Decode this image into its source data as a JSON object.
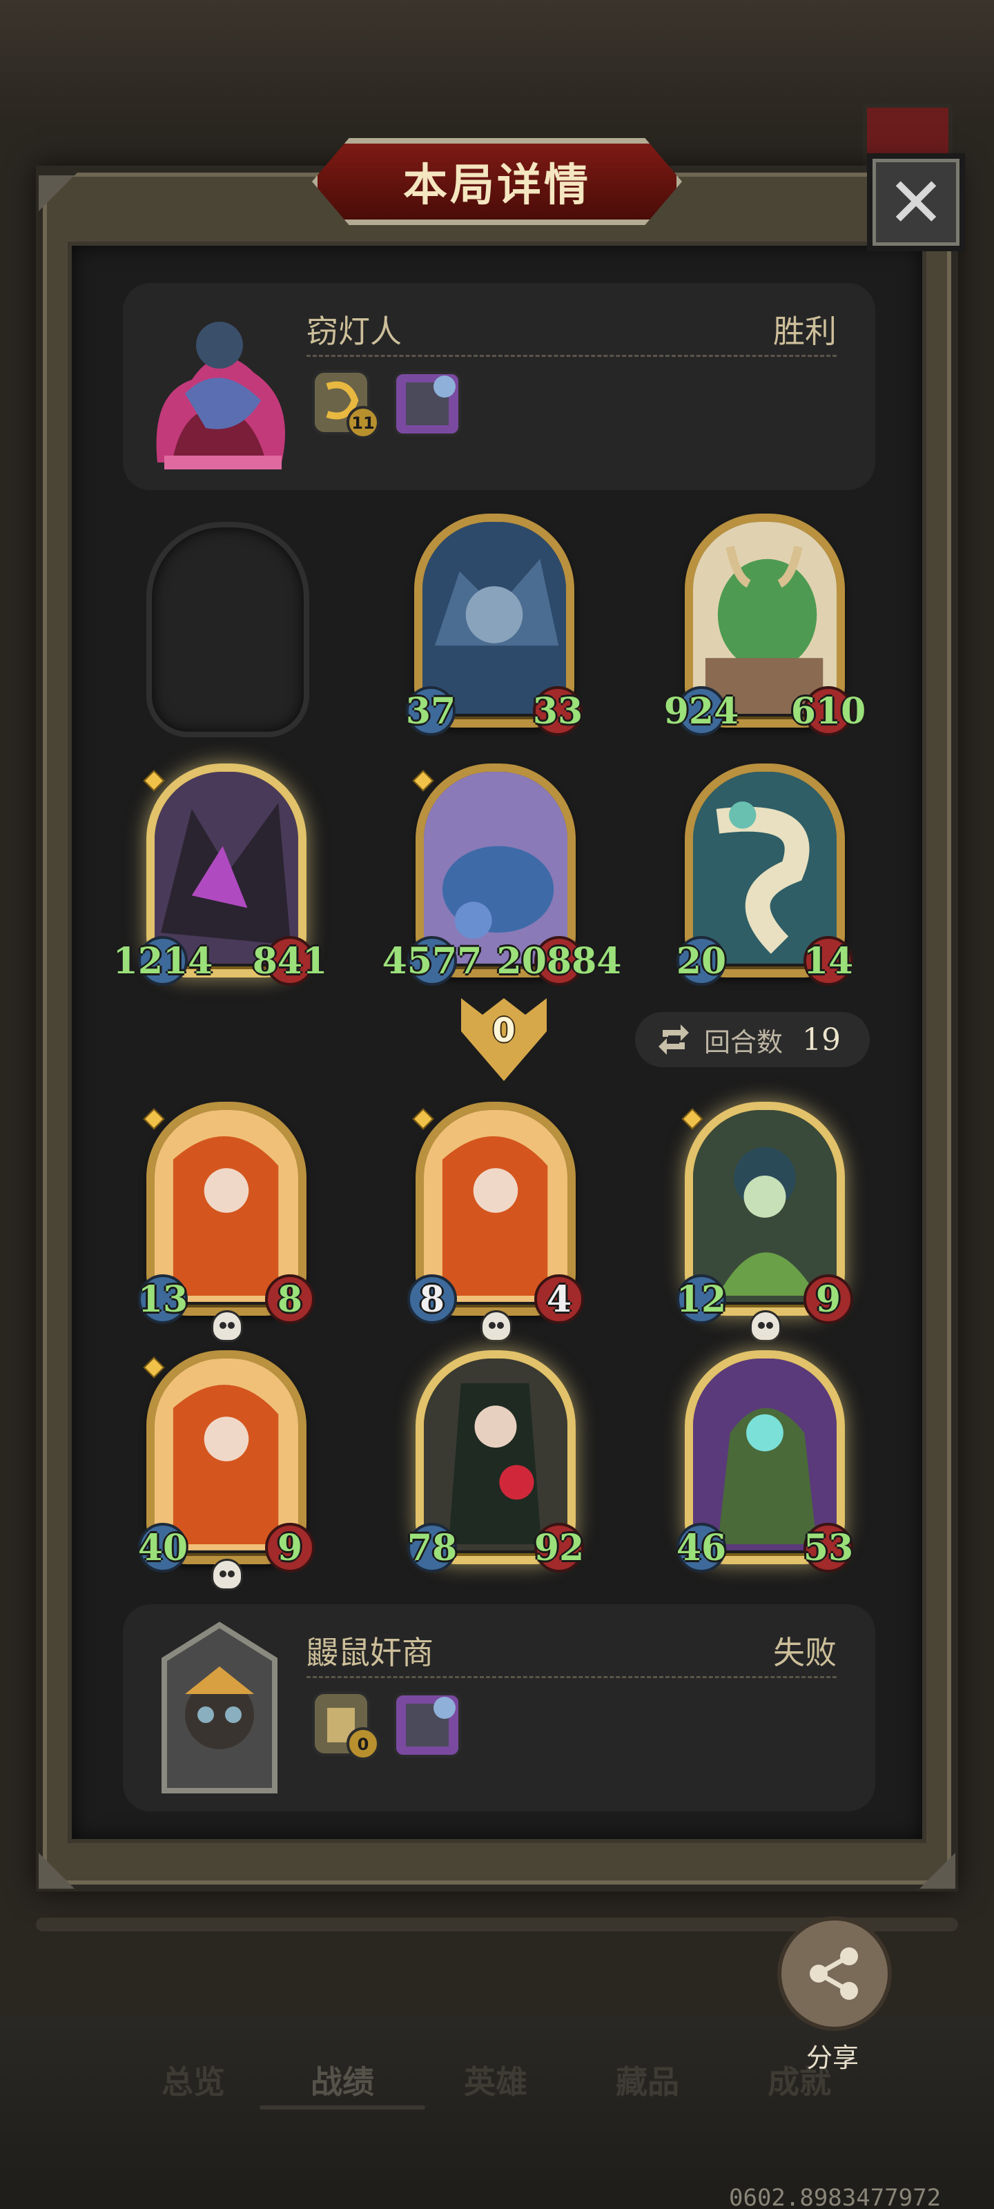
{
  "title": "本局详情",
  "close_icon": "close-icon",
  "top_player": {
    "name": "窃灯人",
    "result": "胜利",
    "item_badge": "11",
    "colors": {
      "accent": "#b9913f"
    }
  },
  "bottom_player": {
    "name": "鼹鼠奸商",
    "result": "失败",
    "item_badge": "0"
  },
  "top_board": [
    {
      "id": "empty"
    },
    {
      "attack": "37",
      "health": "33",
      "golden": false
    },
    {
      "attack": "924",
      "health": "610",
      "golden": false
    },
    {
      "attack": "1214",
      "health": "841",
      "golden": true
    },
    {
      "attack": "4577",
      "health": "20884",
      "golden": false
    },
    {
      "attack": "20",
      "health": "14",
      "golden": false
    }
  ],
  "divider": {
    "value": "0"
  },
  "round": {
    "label": "回合数",
    "value": "19"
  },
  "bottom_board": [
    {
      "attack": "13",
      "health": "8",
      "golden": false,
      "dead": true,
      "white": false
    },
    {
      "attack": "8",
      "health": "4",
      "golden": false,
      "dead": true,
      "white": true
    },
    {
      "attack": "12",
      "health": "9",
      "golden": true,
      "dead": true,
      "white": false
    },
    {
      "attack": "40",
      "health": "9",
      "golden": false,
      "dead": true,
      "white": false
    },
    {
      "attack": "78",
      "health": "92",
      "golden": true,
      "dead": false,
      "white": false
    },
    {
      "attack": "46",
      "health": "53",
      "golden": true,
      "dead": false,
      "white": false
    }
  ],
  "share_label": "分享",
  "nav": [
    "总览",
    "战绩",
    "英雄",
    "藏品",
    "成就"
  ],
  "version": "0602.8983477972"
}
